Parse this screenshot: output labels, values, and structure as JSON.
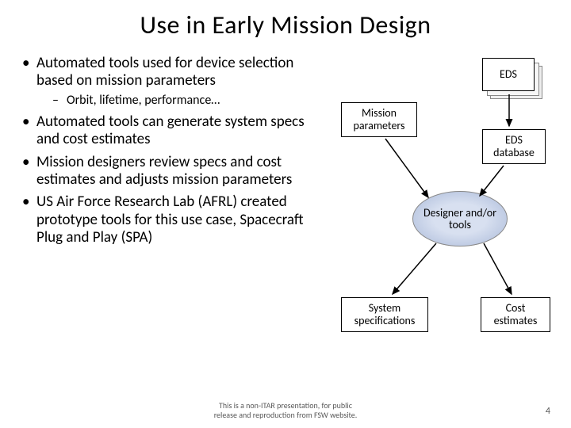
{
  "title": "Use in Early Mission Design",
  "bullets": {
    "b1": "Automated tools used for device selection  based on mission parameters",
    "b1sub": "Orbit, lifetime, performance…",
    "b2": "Automated tools can generate system specs and cost estimates",
    "b3": "Mission designers review specs and cost estimates and adjusts mission parameters",
    "b4": "US Air Force Research Lab (AFRL) created prototype tools for this use case, Spacecraft Plug and Play (SPA)"
  },
  "diagram": {
    "eds": "EDS",
    "mission_params": "Mission parameters",
    "eds_db": "EDS database",
    "designer": "Designer and/or tools",
    "sys_spec": "System specifications",
    "cost_est": "Cost estimates"
  },
  "footer": {
    "line1": "This is a non-ITAR presentation, for public",
    "line2": "release and reproduction from FSW website."
  },
  "page": "4"
}
